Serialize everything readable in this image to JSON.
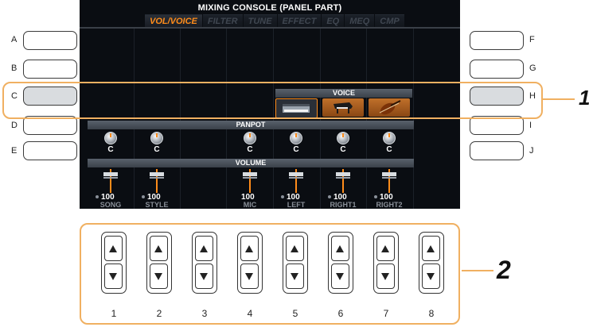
{
  "screen": {
    "title": "MIXING CONSOLE (PANEL PART)",
    "tabs": [
      {
        "label": "VOL/VOICE",
        "active": true
      },
      {
        "label": "FILTER",
        "active": false
      },
      {
        "label": "TUNE",
        "active": false
      },
      {
        "label": "EFFECT",
        "active": false
      },
      {
        "label": "EQ",
        "active": false
      },
      {
        "label": "MEQ",
        "active": false
      },
      {
        "label": "CMP",
        "active": false
      }
    ],
    "voice_header": "VOICE",
    "panpot_header": "PANPOT",
    "volume_header": "VOLUME",
    "voice_icons": [
      "keyboard-icon",
      "grand-piano-icon",
      "violin-icon"
    ],
    "pan_values": [
      "C",
      "C",
      "C",
      "C",
      "C",
      "C"
    ],
    "volume_values": [
      "100",
      "100",
      "100",
      "100",
      "100",
      "100"
    ],
    "channel_labels": [
      "SONG",
      "STYLE",
      "MIC",
      "LEFT",
      "RIGHT1",
      "RIGHT2"
    ],
    "accent_color": "#ff8c1a"
  },
  "left_buttons": [
    "A",
    "B",
    "C",
    "D",
    "E"
  ],
  "right_buttons": [
    "F",
    "G",
    "H",
    "I",
    "J"
  ],
  "callouts": {
    "one": "1",
    "two": "2"
  },
  "bottom_buttons": [
    "1",
    "2",
    "3",
    "4",
    "5",
    "6",
    "7",
    "8"
  ]
}
